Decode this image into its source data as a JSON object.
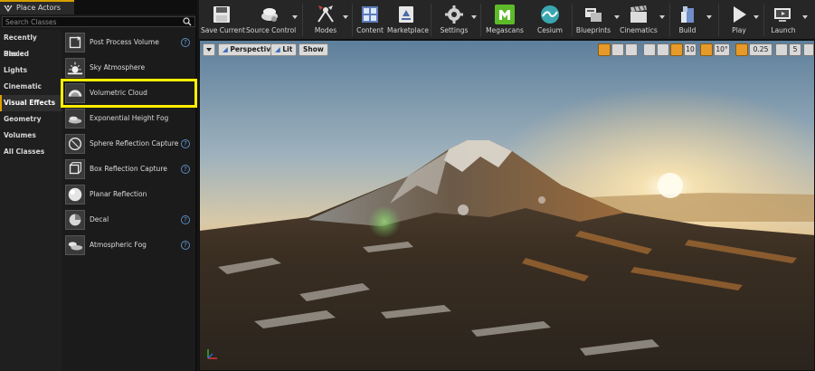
{
  "panel": {
    "tab_title": "Place Actors",
    "search_placeholder": "Search Classes",
    "categories": [
      {
        "label": "Recently Placed"
      },
      {
        "label": "Basic"
      },
      {
        "label": "Lights"
      },
      {
        "label": "Cinematic"
      },
      {
        "label": "Visual Effects"
      },
      {
        "label": "Geometry"
      },
      {
        "label": "Volumes"
      },
      {
        "label": "All Classes"
      }
    ],
    "active_category": "Visual Effects",
    "actors": [
      {
        "label": "Post Process Volume",
        "icon": "post-process-volume-icon"
      },
      {
        "label": "Sky Atmosphere",
        "icon": "sky-atmosphere-icon"
      },
      {
        "label": "Volumetric Cloud",
        "icon": "volumetric-cloud-icon"
      },
      {
        "label": "Exponential Height Fog",
        "icon": "height-fog-icon"
      },
      {
        "label": "Sphere Reflection Capture",
        "icon": "sphere-reflection-icon"
      },
      {
        "label": "Box Reflection Capture",
        "icon": "box-reflection-icon"
      },
      {
        "label": "Planar Reflection",
        "icon": "planar-reflection-icon"
      },
      {
        "label": "Decal",
        "icon": "decal-icon"
      },
      {
        "label": "Atmospheric Fog",
        "icon": "atmospheric-fog-icon"
      }
    ],
    "selected_actor": "Volumetric Cloud",
    "highlight_color": "#ffee00"
  },
  "toolbar": {
    "save_current": "Save Current",
    "source_control": "Source Control",
    "modes": "Modes",
    "content": "Content",
    "marketplace": "Marketplace",
    "settings": "Settings",
    "megascans": "Megascans",
    "cesium": "Cesium",
    "blueprints": "Blueprints",
    "cinematics": "Cinematics",
    "build": "Build",
    "play": "Play",
    "launch": "Launch"
  },
  "viewport": {
    "perspective": "Perspective",
    "lit": "Lit",
    "show": "Show",
    "grid_snap": "10",
    "rotation_snap": "10°",
    "camera_speed_scale": "0.25",
    "camera_speed": "5"
  },
  "colors": {
    "accent": "#e0a000",
    "help_icon": "#5a8cc0",
    "megascans_green": "#5dbb2a",
    "cesium_teal": "#3aa6b0"
  }
}
